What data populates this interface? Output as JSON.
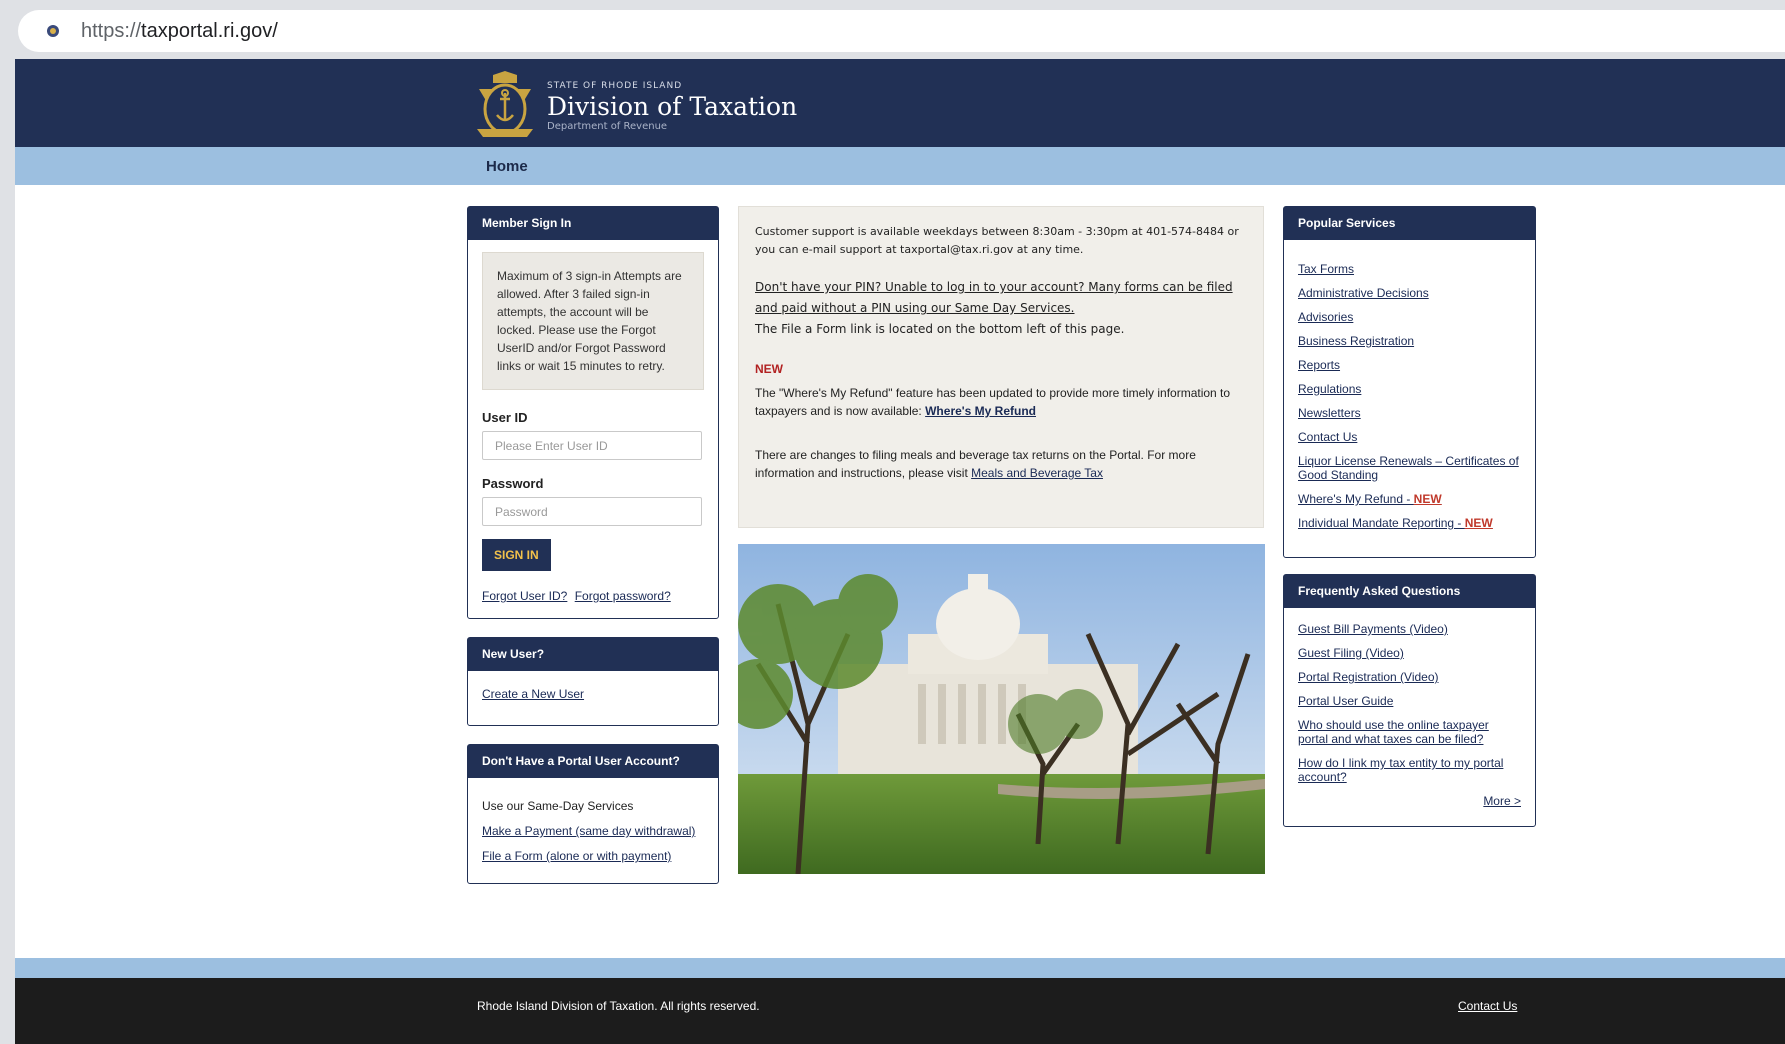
{
  "browser": {
    "url_scheme": "https://",
    "url_host": "taxportal.ri.gov/"
  },
  "header": {
    "state": "STATE OF RHODE ISLAND",
    "title": "Division of Taxation",
    "dept": "Department of Revenue"
  },
  "nav": {
    "home": "Home"
  },
  "signin": {
    "title": "Member Sign In",
    "note": "Maximum of 3 sign-in Attempts are allowed. After 3 failed sign-in attempts, the account will be locked. Please use the Forgot UserID and/or Forgot Password links or wait 15 minutes to retry.",
    "userid_label": "User ID",
    "userid_placeholder": "Please Enter User ID",
    "password_label": "Password",
    "password_placeholder": "Password",
    "button": "SIGN IN",
    "forgot_user": "Forgot User ID?",
    "forgot_password": "Forgot password?"
  },
  "new_user": {
    "title": "New User?",
    "link": "Create a New User"
  },
  "no_account": {
    "title": "Don't Have a Portal User Account?",
    "text": "Use our Same-Day Services",
    "link1": "Make a Payment (same day withdrawal)",
    "link2": "File a Form (alone or with payment)"
  },
  "info": {
    "support": "Customer support is available weekdays between 8:30am - 3:30pm at 401-574-8484 or you can e-mail support at taxportal@tax.ri.gov at any time.",
    "pin_link": "Don't have your PIN? Unable to log in to your account? Many forms can be filed and paid without a PIN using our Same Day Services.",
    "file_form": "The File a Form link is located on the bottom left of this page.",
    "new_heading": "NEW",
    "refund_text": "The \"Where's My Refund\" feature has been updated to provide more timely information to taxpayers and is now available: ",
    "refund_link": "Where's My Refund",
    "meals_text": "There are changes to filing meals and beverage tax returns on the Portal. For more information and instructions, please visit ",
    "meals_link": "Meals and Beverage Tax"
  },
  "popular": {
    "title": "Popular Services",
    "items": [
      "Tax Forms",
      "Administrative Decisions",
      "Advisories",
      "Business Registration",
      "Reports",
      "Regulations",
      "Newsletters",
      "Contact Us",
      "Liquor License Renewals – Certificates of Good Standing"
    ],
    "refund": "Where's My Refund - ",
    "mandate": "Individual Mandate Reporting - ",
    "new_tag": "NEW"
  },
  "faq": {
    "title": "Frequently Asked Questions",
    "items": [
      "Guest Bill Payments (Video)",
      "Guest Filing (Video)",
      "Portal Registration (Video)",
      "Portal User Guide",
      "Who should use the online taxpayer portal and what taxes can be filed?",
      "How do I link my tax entity to my portal account?"
    ],
    "more": "More >"
  },
  "footer": {
    "copy": "Rhode Island Division of Taxation. All rights reserved.",
    "contact": "Contact Us"
  },
  "colors": {
    "navy": "#213055",
    "light_blue": "#9cbfe0",
    "gold": "#f2c14b",
    "new_red": "#c0392b"
  }
}
